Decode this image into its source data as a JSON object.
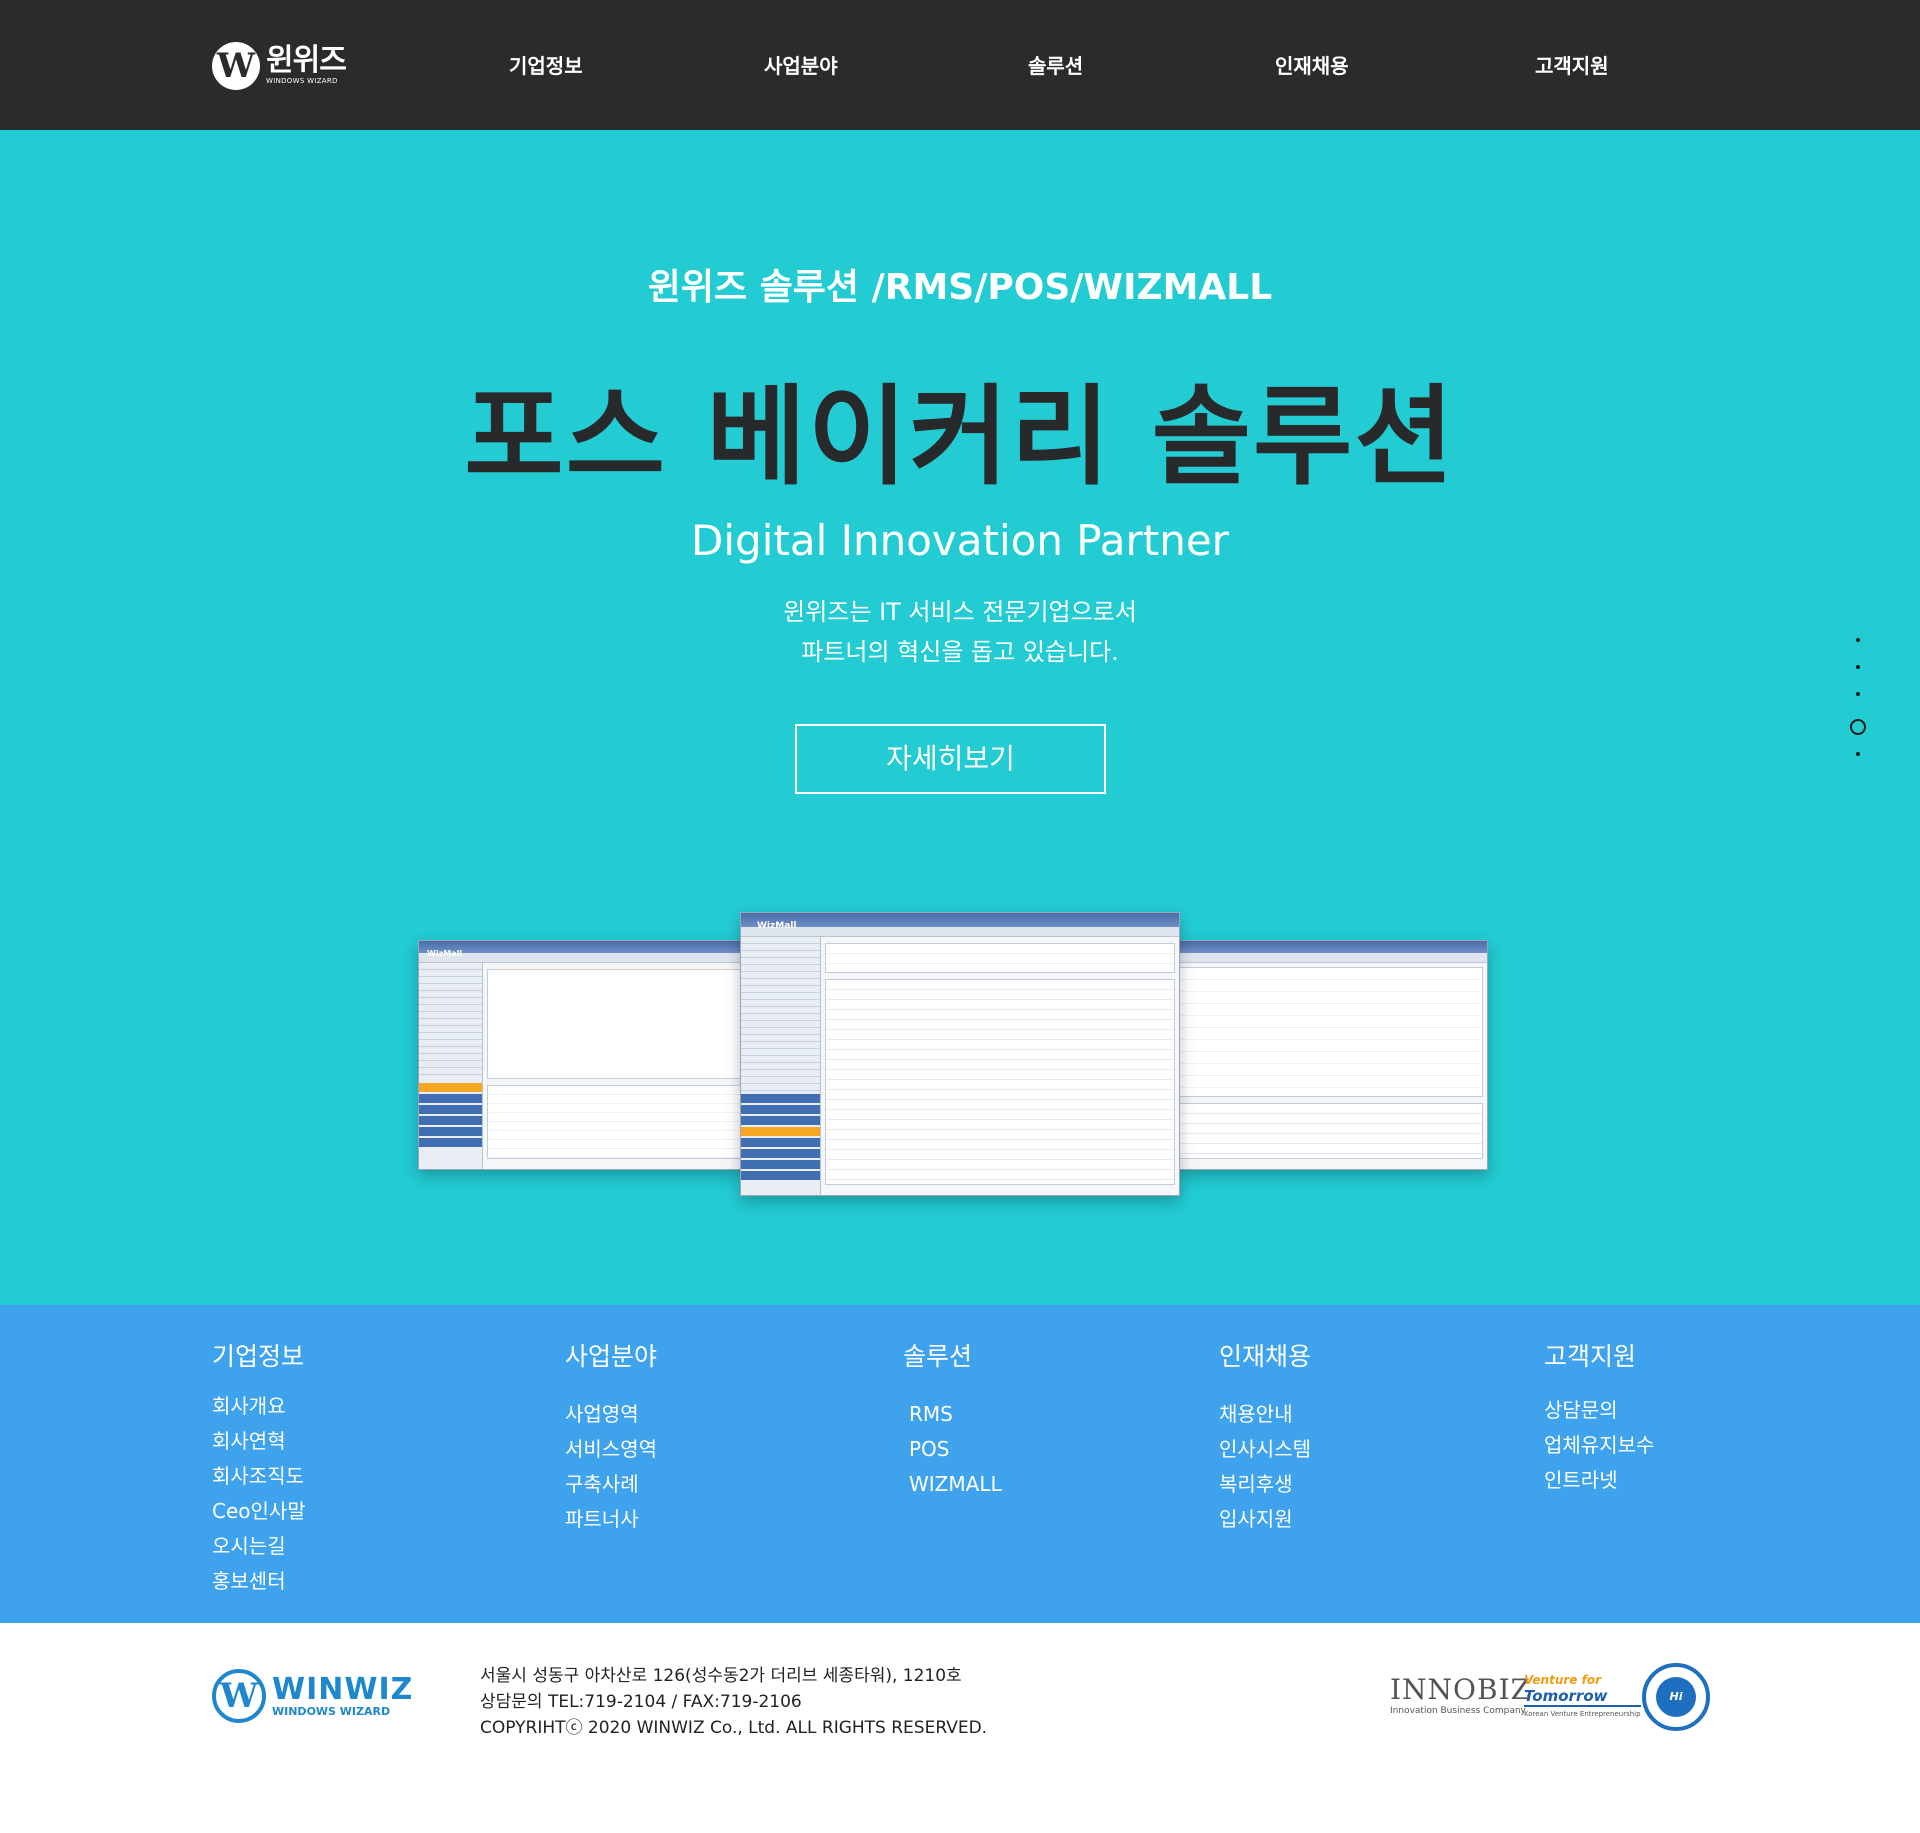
{
  "header": {
    "logo": {
      "kr": "윈위즈",
      "en": "WINDOWS WIZARD"
    },
    "nav": [
      "기업정보",
      "사업분야",
      "솔루션",
      "인재채용",
      "고객지원"
    ]
  },
  "hero": {
    "subtitle": "윈위즈 솔루션 /RMS/POS/WIZMALL",
    "title": "포스 베이커리 솔루션",
    "tagline": "Digital Innovation Partner",
    "desc_line1": "윈위즈는 IT 서비스 전문기업으로서",
    "desc_line2": "파트너의 혁신을 돕고 있습니다.",
    "button": "자세히보기",
    "slide_count": 5,
    "active_slide": 4,
    "screenshot_app_title": "WizMall"
  },
  "footer_links": [
    {
      "title": "기업정보",
      "items": [
        "회사개요",
        "회사연혁",
        "회사조직도",
        "Ceo인사말",
        "오시는길",
        "홍보센터"
      ]
    },
    {
      "title": "사업분야",
      "items": [
        "사업영역",
        "서비스영역",
        "구축사례",
        "파트너사"
      ]
    },
    {
      "title": "솔루션",
      "items": [
        "RMS",
        "POS",
        "WIZMALL"
      ]
    },
    {
      "title": "인재채용",
      "items": [
        "채용안내",
        "인사시스템",
        "복리후생",
        "입사지원"
      ]
    },
    {
      "title": "고객지원",
      "items": [
        "상담문의",
        "업체유지보수",
        "인트라넷"
      ]
    }
  ],
  "footer": {
    "logo": {
      "kr": "WINWIZ",
      "en": "WINDOWS WIZARD"
    },
    "address": "서울시 성동구 아차산로 126(성수동2가 더리브 세종타워), 1210호",
    "contact": "상담문의 TEL:719-2104 / FAX:719-2106",
    "copyright": "COPYRIHTⓒ 2020 WINWIZ Co., Ltd. ALL RIGHTS RESERVED.",
    "certs": {
      "innobiz_main": "INNOBIZ",
      "innobiz_sub": "Innovation Business Company",
      "venture_1": "Venture for",
      "venture_2": "Tomorrow",
      "venture_3": "Korean Venture Entrepreneurship",
      "seal_text": "Hi Seoul"
    }
  },
  "colors": {
    "header_bg": "#2b2b2d",
    "hero_bg": "#23cbd3",
    "footer_links_bg": "#3ea2ec",
    "title_text": "#27292b",
    "brand_blue": "#1f87cc"
  }
}
